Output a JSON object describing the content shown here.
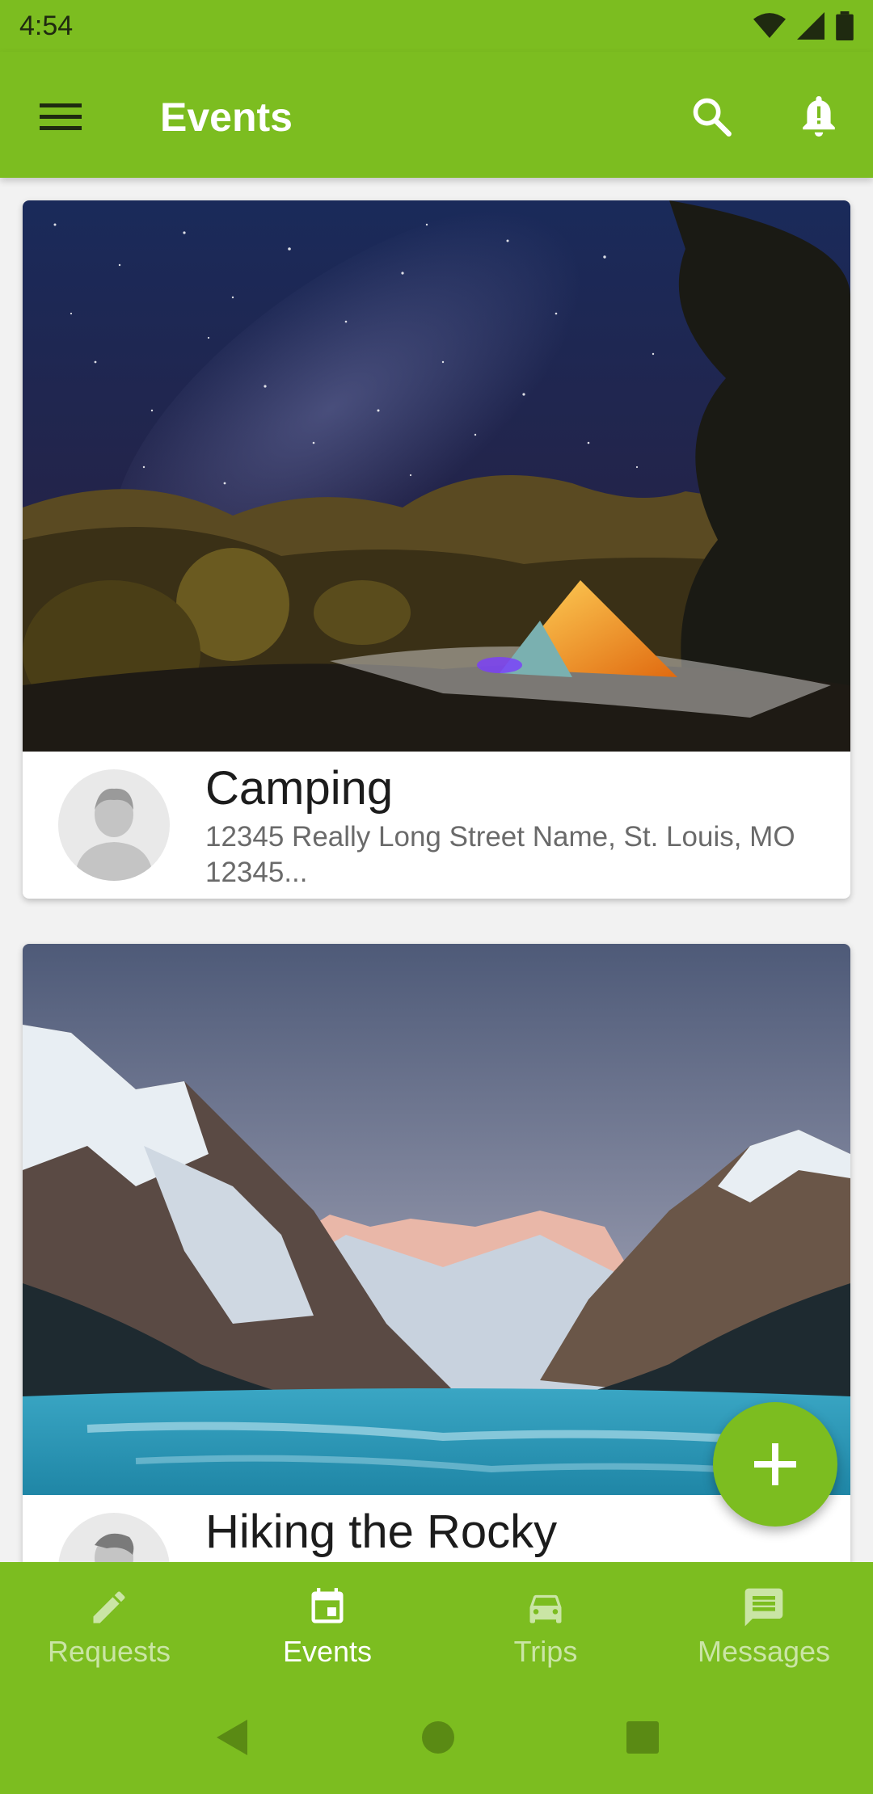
{
  "status_bar": {
    "time": "4:54"
  },
  "app_bar": {
    "title": "Events"
  },
  "events": [
    {
      "title": "Camping",
      "address": "12345 Really Long Street Name, St. Louis, MO 12345..."
    },
    {
      "title": "Hiking the Rocky",
      "address": ""
    }
  ],
  "bottom_nav": {
    "items": [
      {
        "label": "Requests",
        "icon": "pencil-icon",
        "active": false
      },
      {
        "label": "Events",
        "icon": "calendar-icon",
        "active": true
      },
      {
        "label": "Trips",
        "icon": "car-icon",
        "active": false
      },
      {
        "label": "Messages",
        "icon": "message-icon",
        "active": false
      }
    ]
  },
  "colors": {
    "accent": "#7cbd20",
    "on_accent": "#ffffff"
  }
}
